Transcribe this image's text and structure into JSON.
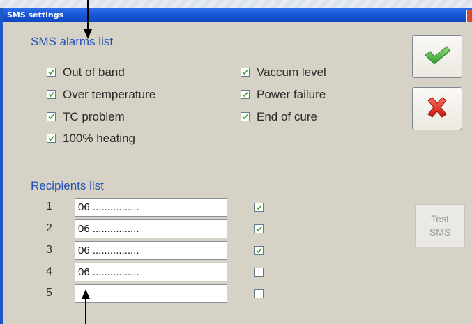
{
  "window": {
    "title": "SMS settings"
  },
  "alarms": {
    "title": "SMS alarms list",
    "items": [
      {
        "label": "Out of band",
        "checked": true
      },
      {
        "label": "Over temperature",
        "checked": true
      },
      {
        "label": "TC problem",
        "checked": true
      },
      {
        "label": "100% heating",
        "checked": true
      },
      {
        "label": "Vaccum level",
        "checked": true
      },
      {
        "label": "Power failure",
        "checked": true
      },
      {
        "label": "End of cure",
        "checked": true
      }
    ]
  },
  "recipients": {
    "title": "Recipients list",
    "rows": [
      {
        "num": "1",
        "phone": "06 ................",
        "enabled": true
      },
      {
        "num": "2",
        "phone": "06 ................",
        "enabled": true
      },
      {
        "num": "3",
        "phone": "06 ................",
        "enabled": true
      },
      {
        "num": "4",
        "phone": "06 ................",
        "enabled": false
      },
      {
        "num": "5",
        "phone": "",
        "enabled": false
      }
    ]
  },
  "buttons": {
    "ok_icon": "check-icon",
    "cancel_icon": "cross-icon",
    "test_line1": "Test",
    "test_line2": "SMS"
  },
  "colors": {
    "title_bar": "#1957d6",
    "section_title": "#2552b8",
    "check_green": "#3aa330",
    "cross_red": "#d9261c"
  }
}
